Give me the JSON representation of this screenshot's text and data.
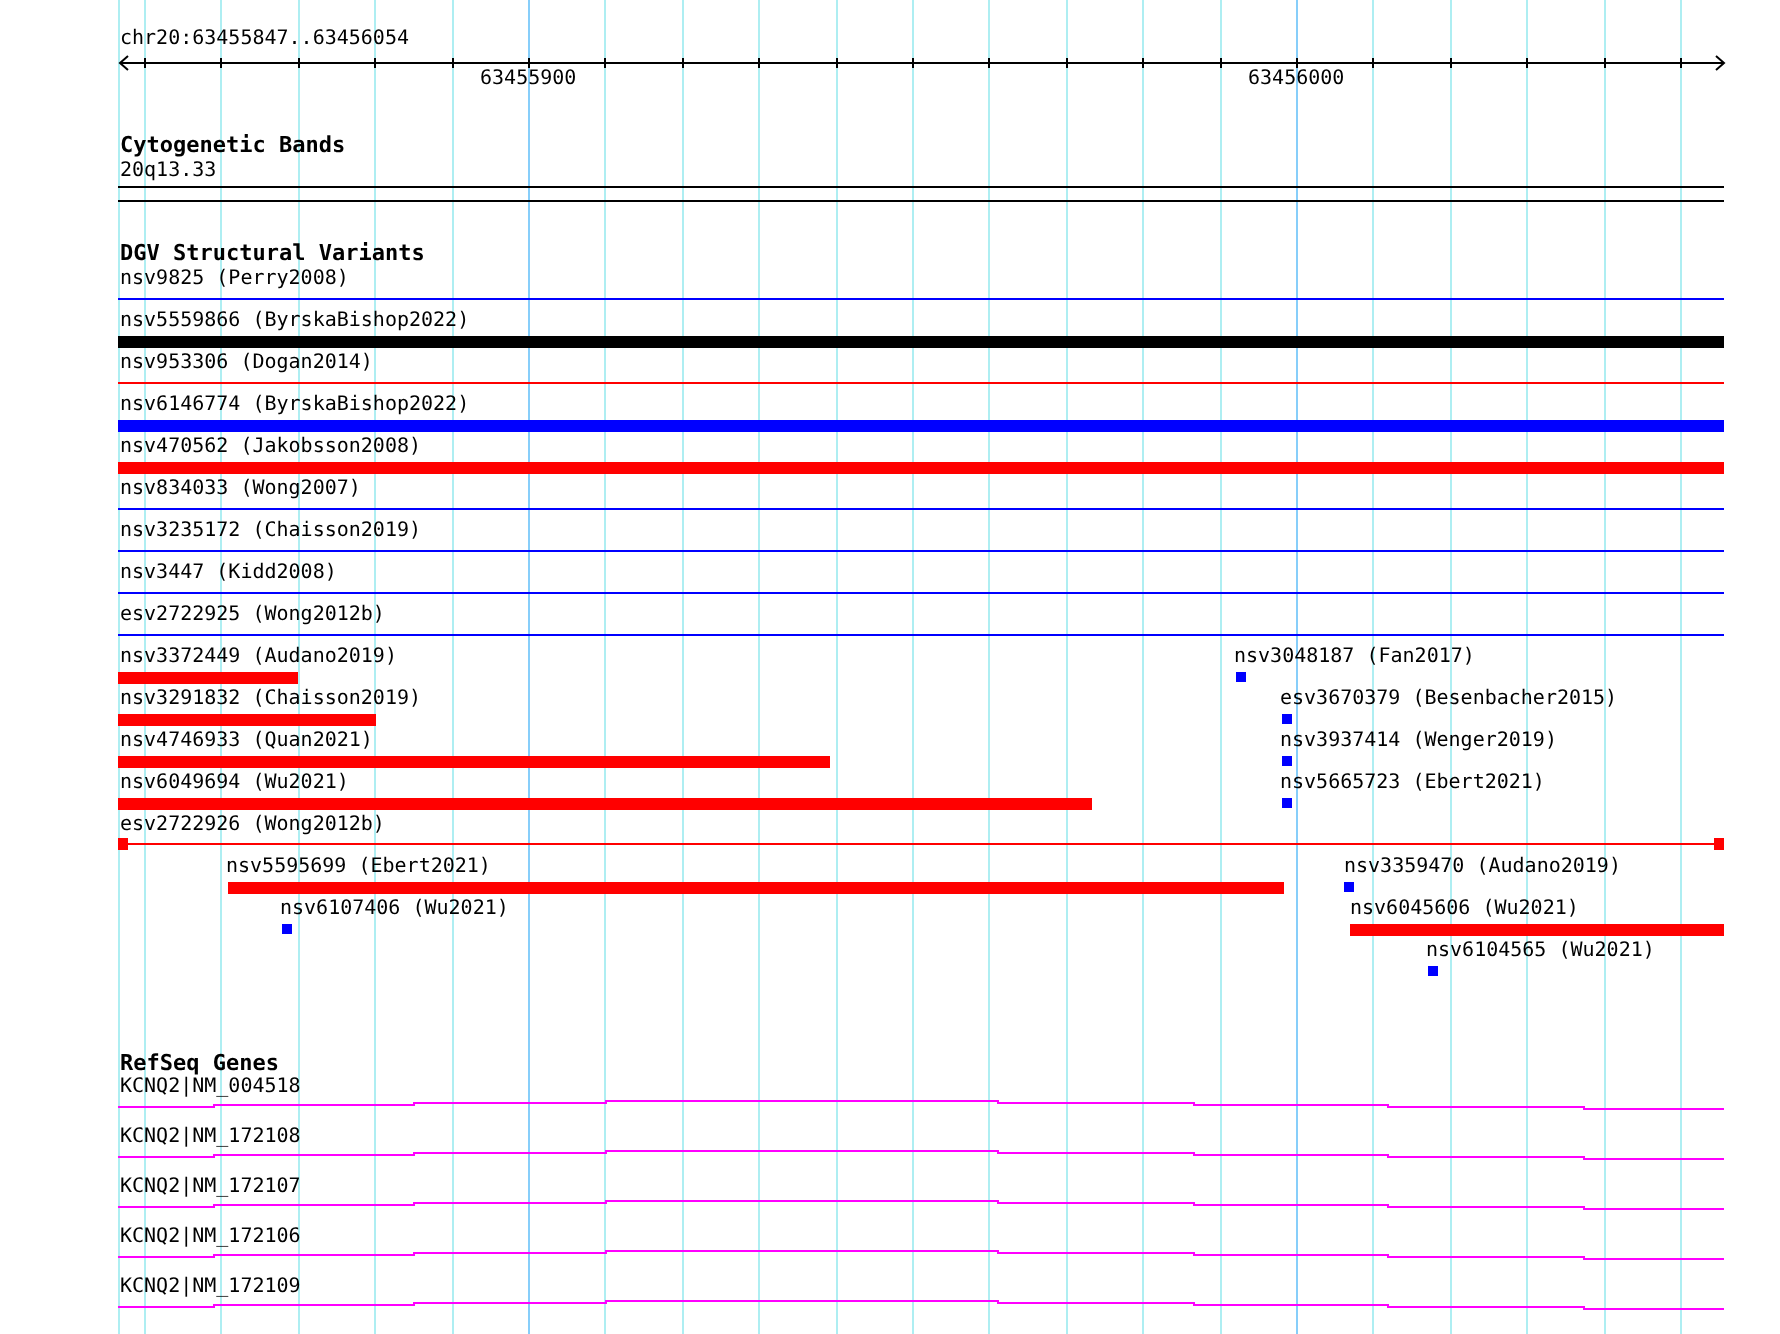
{
  "ruler": {
    "location": "chr20:63455847..63456054",
    "ticks": [
      "63455900",
      "63456000"
    ]
  },
  "cytogenetic_bands": {
    "title": "Cytogenetic Bands",
    "band": "20q13.33"
  },
  "dgv": {
    "title": "DGV Structural Variants",
    "variants": [
      {
        "label": "nsv9825 (Perry2008)",
        "kind": "line",
        "color": "#0000ff"
      },
      {
        "label": "nsv5559866 (ByrskaBishop2022)",
        "kind": "bar",
        "color": "#000000"
      },
      {
        "label": "nsv953306 (Dogan2014)",
        "kind": "line",
        "color": "#ff0000"
      },
      {
        "label": "nsv6146774 (ByrskaBishop2022)",
        "kind": "bar",
        "color": "#0000ff"
      },
      {
        "label": "nsv470562 (Jakobsson2008)",
        "kind": "bar",
        "color": "#ff0000"
      },
      {
        "label": "nsv834033 (Wong2007)",
        "kind": "line",
        "color": "#0000ff"
      },
      {
        "label": "nsv3235172 (Chaisson2019)",
        "kind": "line",
        "color": "#0000ff"
      },
      {
        "label": "nsv3447 (Kidd2008)",
        "kind": "line",
        "color": "#0000ff"
      },
      {
        "label": "esv2722925 (Wong2012b)",
        "kind": "line",
        "color": "#0000ff"
      },
      {
        "label": "nsv3372449 (Audano2019)",
        "kind": "bar",
        "color": "#ff0000"
      },
      {
        "label": "nsv3048187 (Fan2017)",
        "kind": "point",
        "color": "#0000ff"
      },
      {
        "label": "nsv3291832 (Chaisson2019)",
        "kind": "bar",
        "color": "#ff0000"
      },
      {
        "label": "esv3670379 (Besenbacher2015)",
        "kind": "point",
        "color": "#0000ff"
      },
      {
        "label": "nsv4746933 (Quan2021)",
        "kind": "bar",
        "color": "#ff0000"
      },
      {
        "label": "nsv3937414 (Wenger2019)",
        "kind": "point",
        "color": "#0000ff"
      },
      {
        "label": "nsv6049694 (Wu2021)",
        "kind": "bar",
        "color": "#ff0000"
      },
      {
        "label": "nsv5665723 (Ebert2021)",
        "kind": "point",
        "color": "#0000ff"
      },
      {
        "label": "esv2722926 (Wong2012b)",
        "kind": "span",
        "color": "#ff0000"
      },
      {
        "label": "nsv5595699 (Ebert2021)",
        "kind": "bar",
        "color": "#ff0000"
      },
      {
        "label": "nsv3359470 (Audano2019)",
        "kind": "point",
        "color": "#0000ff"
      },
      {
        "label": "nsv6107406 (Wu2021)",
        "kind": "point",
        "color": "#0000ff"
      },
      {
        "label": "nsv6045606 (Wu2021)",
        "kind": "bar",
        "color": "#ff0000"
      },
      {
        "label": "nsv6104565 (Wu2021)",
        "kind": "point",
        "color": "#0000ff"
      }
    ]
  },
  "refseq": {
    "title": "RefSeq Genes",
    "genes": [
      {
        "label": "KCNQ2|NM_004518"
      },
      {
        "label": "KCNQ2|NM_172108"
      },
      {
        "label": "KCNQ2|NM_172107"
      },
      {
        "label": "KCNQ2|NM_172106"
      },
      {
        "label": "KCNQ2|NM_172109"
      }
    ]
  }
}
